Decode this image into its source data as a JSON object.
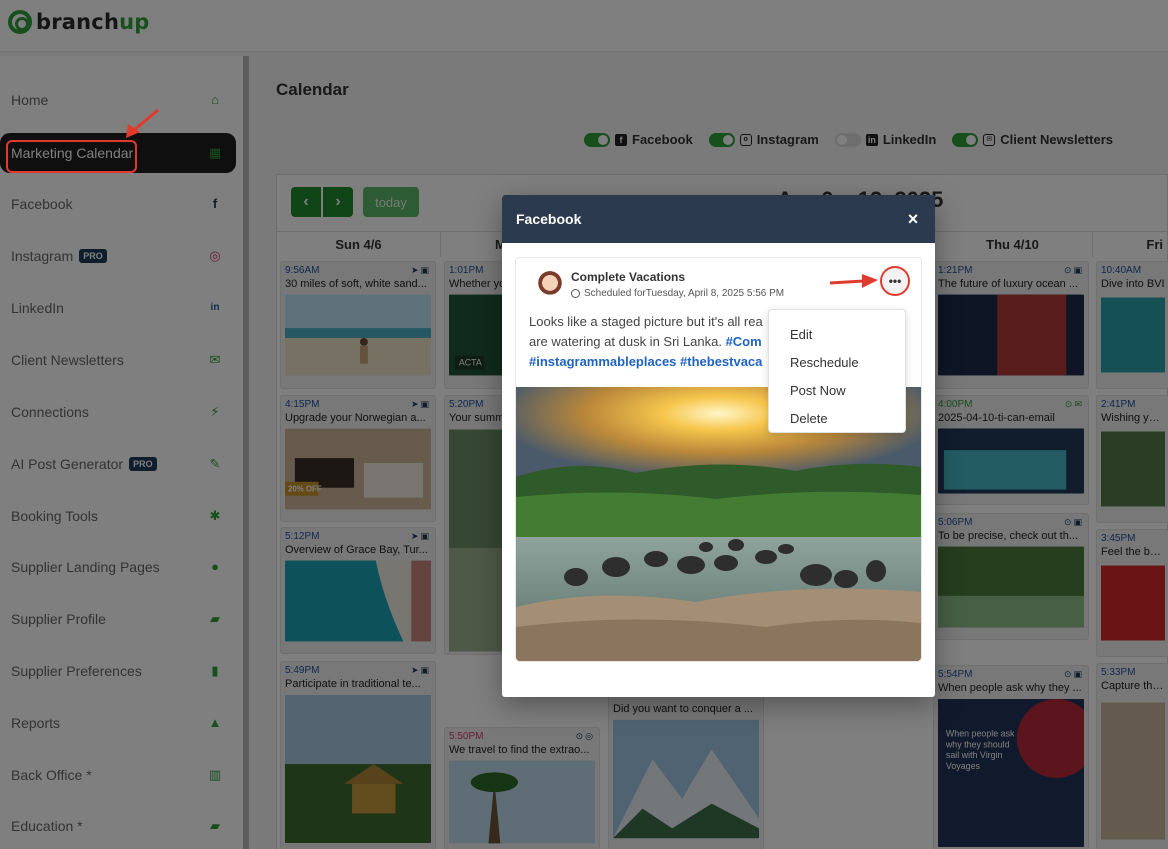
{
  "brand": {
    "part1": "branch",
    "part2": "up"
  },
  "sidebar": {
    "items": [
      {
        "label": "Home",
        "icon": "home-icon",
        "glyph": "⌂"
      },
      {
        "label": "Marketing Calendar",
        "icon": "calendar-icon",
        "glyph": "▦",
        "active": true
      },
      {
        "label": "Facebook",
        "icon": "facebook-icon",
        "glyph": "f"
      },
      {
        "label": "Instagram",
        "icon": "instagram-icon",
        "glyph": "◎",
        "badge": "PRO"
      },
      {
        "label": "LinkedIn",
        "icon": "linkedin-icon",
        "glyph": "in"
      },
      {
        "label": "Client Newsletters",
        "icon": "envelope-icon",
        "glyph": "✉"
      },
      {
        "label": "Connections",
        "icon": "plug-icon",
        "glyph": "⚡"
      },
      {
        "label": "AI Post Generator",
        "icon": "edit-icon",
        "glyph": "✎",
        "badge": "PRO"
      },
      {
        "label": "Booking Tools",
        "icon": "wrench-icon",
        "glyph": "🔧"
      },
      {
        "label": "Supplier Landing Pages",
        "icon": "globe-icon",
        "glyph": "●"
      },
      {
        "label": "Supplier Profile",
        "icon": "book-icon",
        "glyph": "▰"
      },
      {
        "label": "Supplier Preferences",
        "icon": "bookmark-icon",
        "glyph": "▮"
      },
      {
        "label": "Reports",
        "icon": "chart-icon",
        "glyph": "▲"
      },
      {
        "label": "Back Office *",
        "icon": "map-icon",
        "glyph": "▥"
      },
      {
        "label": "Education *",
        "icon": "book-icon",
        "glyph": "▰"
      }
    ]
  },
  "main": {
    "title": "Calendar",
    "filters": [
      {
        "label": "Facebook",
        "on": true
      },
      {
        "label": "Instagram",
        "on": true
      },
      {
        "label": "LinkedIn",
        "on": false
      },
      {
        "label": "Client Newsletters",
        "on": true
      }
    ],
    "toolbar": {
      "prev": "‹",
      "next": "›",
      "today": "today",
      "range_partial": "Apr 6 – 12, 2025"
    },
    "columns": [
      "Sun 4/6",
      "M",
      "",
      "",
      "Thu 4/10",
      "Fri"
    ],
    "posts": {
      "sun": [
        {
          "time": "9:56AM",
          "text": "30 miles of soft, white sand..."
        },
        {
          "time": "4:15PM",
          "text": "Upgrade your Norwegian a..."
        },
        {
          "time": "5:12PM",
          "text": "Overview of Grace Bay, Tur..."
        },
        {
          "time": "5:49PM",
          "text": "Participate in traditional te..."
        }
      ],
      "mon": [
        {
          "time": "1:01PM",
          "text": "Whether yo"
        },
        {
          "time": "5:20PM",
          "text": "Your summ"
        },
        {
          "time": "5:50PM",
          "text": "We travel to find the extrao..."
        }
      ],
      "tue": [
        {
          "time": "",
          "text": "Did you want to conquer a ..."
        }
      ],
      "thu": [
        {
          "time": "1:21PM",
          "text": "The future of luxury ocean ..."
        },
        {
          "time": "4:00PM",
          "text": "2025-04-10-ti-can-email"
        },
        {
          "time": "5:06PM",
          "text": "To be precise, check out th..."
        },
        {
          "time": "5:54PM",
          "text": "When people ask why they ..."
        }
      ],
      "fri": [
        {
          "time": "10:40AM",
          "text": "Dive into BVI"
        },
        {
          "time": "2:41PM",
          "text": "Wishing you w"
        },
        {
          "time": "3:45PM",
          "text": "Feel the beat,"
        },
        {
          "time": "5:33PM",
          "text": "Capture the w"
        }
      ]
    },
    "img_text": {
      "discount": "20% OFF",
      "acta": "ACTA",
      "virgin": "When people ask why they should sail with Virgin Voyages"
    }
  },
  "modal": {
    "title": "Facebook",
    "close": "×",
    "author": "Complete Vacations",
    "scheduled": "Scheduled forTuesday, April 8, 2025 5:56 PM",
    "caption_line1": "Looks like a staged picture but it's all rea",
    "caption_line2a": "are watering at dusk in Sri Lanka. ",
    "caption_tag1": "#Com",
    "caption_tag2": "#instagrammableplaces #thebestvaca",
    "more": "•••",
    "menu": [
      "Edit",
      "Reschedule",
      "Post Now",
      "Delete"
    ]
  },
  "colors": {
    "brand_green": "#2e9e3a",
    "modal_header": "#2b3a4f",
    "annotation_red": "#e03a2e"
  }
}
